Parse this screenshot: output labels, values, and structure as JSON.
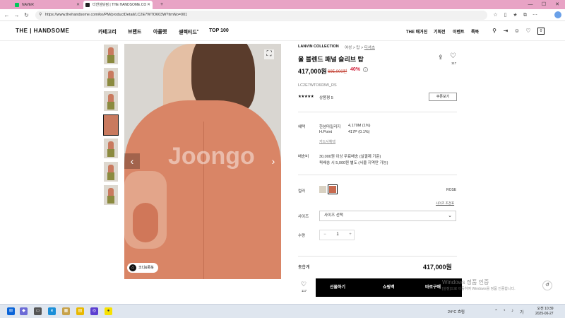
{
  "browser": {
    "tabs": [
      {
        "title": "NAVER",
        "color": "#03c75a"
      },
      {
        "title": "더한섬닷컴 | THE HANDSOME.CO",
        "color": "#222222"
      }
    ],
    "url": "https://www.thehandsome.com/ko/PM/productDetail/LC2E7WTO603W?itmNo=001",
    "new_tab": "+",
    "minimize": "—",
    "maximize": "☐",
    "close": "✕"
  },
  "site": {
    "logo": "THE | HANDSOME",
    "nav": [
      "카테고리",
      "브랜드",
      "아울렛",
      "셀렉티드",
      "TOP 100"
    ],
    "util_links": [
      "THE 매거진",
      "기획전",
      "이벤트",
      "룩북"
    ],
    "cart_count": "0"
  },
  "gallery": {
    "watermark": "Joongo",
    "zoom_label": "코디&룩북"
  },
  "product": {
    "brand": "LANVIN COLLECTION",
    "breadcrumb": [
      "여성",
      "탑",
      "티셔츠"
    ],
    "name": "울 블렌드 패널 슬리브 탑",
    "wish_count": "117",
    "price": "417,000원",
    "original_price": "695,000원",
    "discount": "40%",
    "code": "LC2E7WTO603W_RS",
    "stars": "★★★★★",
    "review_label": "상품평 5",
    "coupon_button": "쿠폰보기"
  },
  "benefits": {
    "label": "혜택",
    "items": [
      {
        "name": "한섬마일리지",
        "value": "4,170M (1%)"
      },
      {
        "name": "H.Point",
        "value": "417P (0.1%)"
      }
    ],
    "card_link": "카드사혜택"
  },
  "shipping": {
    "label": "배송비",
    "line1": "30,000원 이상 무료배송 (실결제 기준)",
    "line2": "퀵배송 시 5,000원 별도 (서울 지역만 가능)"
  },
  "color": {
    "label": "컬러",
    "selected": "ROSE",
    "swatches": [
      "#d9d2c3",
      "#c86a4f"
    ]
  },
  "size": {
    "label": "사이즈",
    "guide": "사이즈 조견표",
    "placeholder": "사이즈 선택"
  },
  "quantity": {
    "label": "수량",
    "value": "1",
    "minus": "−",
    "plus": "+"
  },
  "total": {
    "label": "총합계",
    "amount": "417,000원"
  },
  "actions": {
    "wish_count": "117",
    "gift": "선물하기",
    "cart": "쇼핑백",
    "buy": "바로구매"
  },
  "windows": {
    "activate_title": "Windows 정품 인증",
    "activate_sub": "[설정]으로 이동하여 Windows를 정품 인증합니다."
  },
  "taskbar": {
    "weather": "24°C 흐림",
    "time": "오전 10:39",
    "date": "2025-06-27"
  }
}
